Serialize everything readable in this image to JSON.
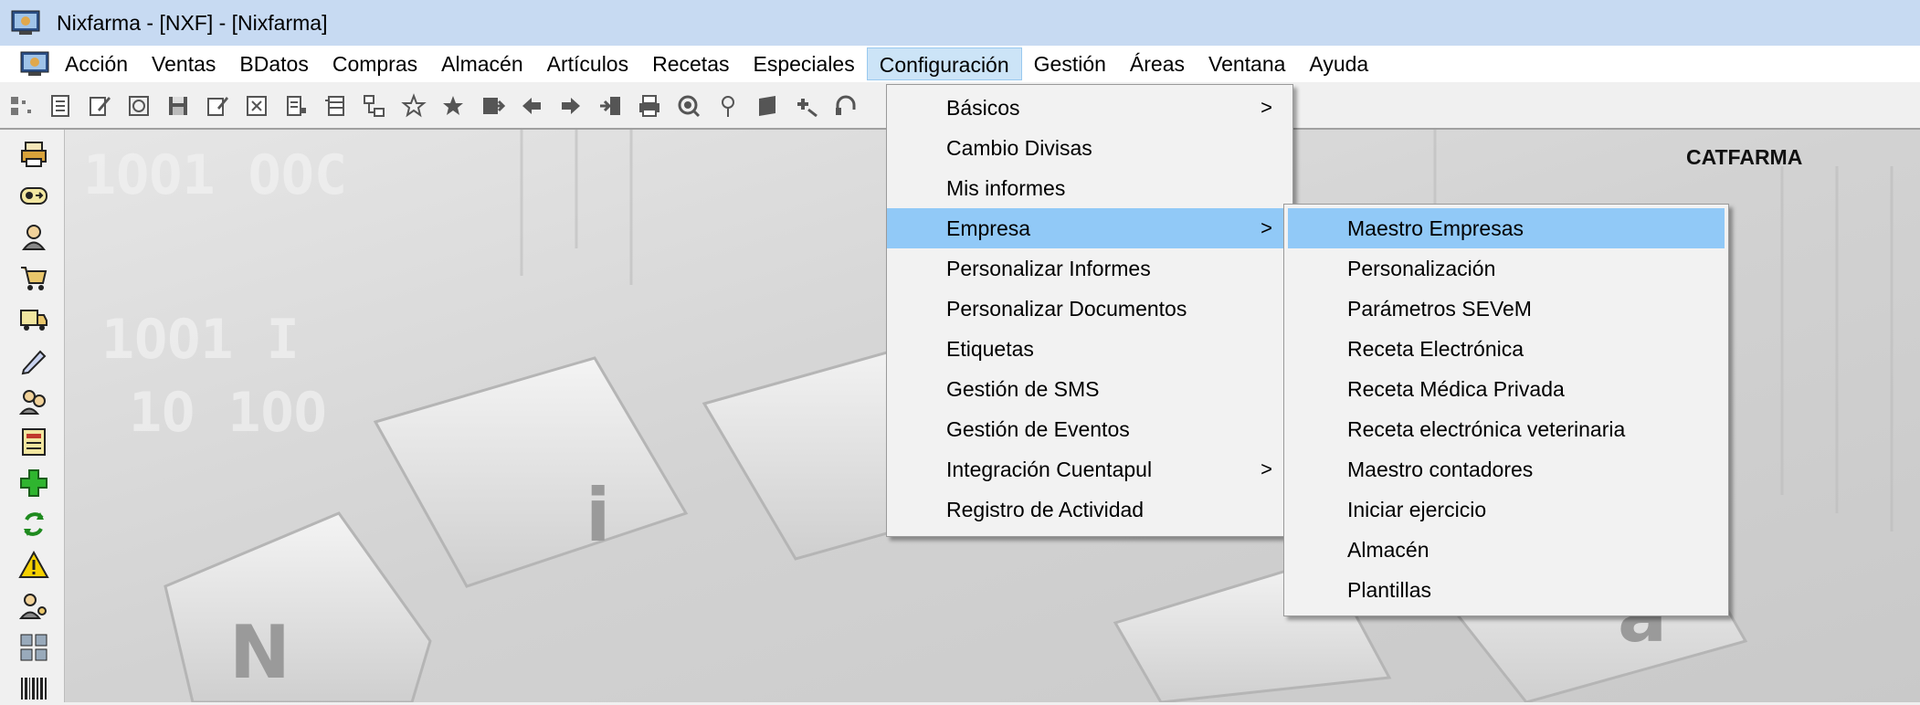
{
  "window": {
    "title": "Nixfarma - [NXF] - [Nixfarma]"
  },
  "menubar": {
    "items": [
      "Acción",
      "Ventas",
      "BDatos",
      "Compras",
      "Almacén",
      "Artículos",
      "Recetas",
      "Especiales",
      "Configuración",
      "Gestión",
      "Áreas",
      "Ventana",
      "Ayuda"
    ],
    "active": "Configuración"
  },
  "toolbar": {
    "icons": [
      "grid-icon",
      "document-icon",
      "edit-icon",
      "object-icon",
      "save-icon",
      "form-icon",
      "close-box-icon",
      "list-icon",
      "table-icon",
      "tree-icon",
      "star-outline-icon",
      "star-filled-icon",
      "insert-icon",
      "arrow-left-icon",
      "arrow-right-icon",
      "exit-icon",
      "print-icon",
      "search-icon",
      "pin-icon",
      "stack-icon",
      "plus-arrow-icon",
      "headset-icon"
    ]
  },
  "lefttools": {
    "icons": [
      "printer-icon",
      "badge-icon",
      "user-icon",
      "cart-icon",
      "truck-icon",
      "pen-icon",
      "users-icon",
      "document-list-icon",
      "add-icon",
      "refresh-icon",
      "warning-icon",
      "person-key-icon",
      "group-icon",
      "barcode-icon"
    ]
  },
  "desk": {
    "label": "CATFARMA"
  },
  "config_menu": {
    "items": [
      {
        "label": "Básicos",
        "submenu": true
      },
      {
        "label": "Cambio Divisas",
        "submenu": false
      },
      {
        "label": "Mis informes",
        "submenu": false
      },
      {
        "label": "Empresa",
        "submenu": true,
        "highlighted": true
      },
      {
        "label": "Personalizar Informes",
        "submenu": false
      },
      {
        "label": "Personalizar Documentos",
        "submenu": false
      },
      {
        "label": "Etiquetas",
        "submenu": false
      },
      {
        "label": "Gestión de SMS",
        "submenu": false
      },
      {
        "label": "Gestión de Eventos",
        "submenu": false
      },
      {
        "label": "Integración Cuentapul",
        "submenu": true
      },
      {
        "label": "Registro de Actividad",
        "submenu": false
      }
    ],
    "arrow": ">"
  },
  "empresa_menu": {
    "items": [
      {
        "label": "Maestro Empresas",
        "highlighted": true
      },
      {
        "label": "Personalización"
      },
      {
        "label": "Parámetros SEVeM"
      },
      {
        "label": "Receta Electrónica"
      },
      {
        "label": "Receta Médica Privada"
      },
      {
        "label": "Receta electrónica veterinaria"
      },
      {
        "label": "Maestro contadores"
      },
      {
        "label": "Iniciar ejercicio"
      },
      {
        "label": "Almacén"
      },
      {
        "label": "Plantillas"
      }
    ]
  },
  "colors": {
    "titlebar": "#c7daf2",
    "highlight": "#91c9f7",
    "menu_bg": "#f2f2f2"
  }
}
